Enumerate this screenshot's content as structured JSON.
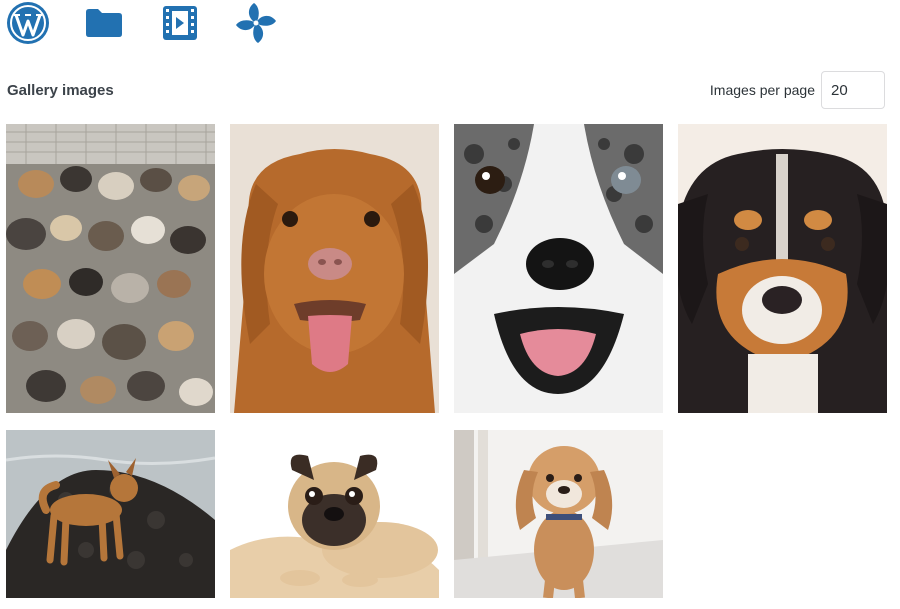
{
  "toolbar": {
    "icons": [
      "wordpress-logo",
      "folder-icon",
      "video-icon",
      "pinwheel-icon"
    ],
    "accent_color": "#2271b1"
  },
  "gallery": {
    "title": "Gallery images",
    "per_page_label": "Images per page",
    "per_page_value": "20",
    "images": [
      {
        "subject": "pack-of-dogs"
      },
      {
        "subject": "golden-retriever-smiling"
      },
      {
        "subject": "merle-dog-closeup"
      },
      {
        "subject": "tricolor-puppy"
      },
      {
        "subject": "dog-on-rock-by-water"
      },
      {
        "subject": "pug-lying-down"
      },
      {
        "subject": "fluffy-puppy-standing"
      }
    ]
  }
}
